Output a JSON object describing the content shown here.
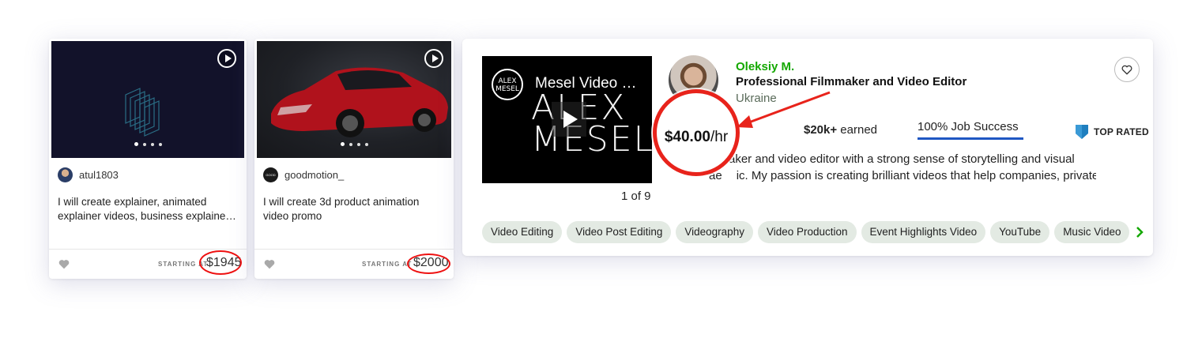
{
  "gig_cards": [
    {
      "seller": "atul1803",
      "title_line1": "I will create explainer, animated",
      "title_line2": "explainer videos, business explaine…",
      "starting_at": "STARTING AT",
      "price": "$1945"
    },
    {
      "seller": "goodmotion_",
      "seller_avatar_text": "GOOD MOTION",
      "title_line1": "I will create 3d product animation",
      "title_line2": "video promo",
      "starting_at": "STARTING AT",
      "price": "$2000"
    }
  ],
  "freelancer": {
    "name": "Oleksiy M.",
    "headline": "Professional Filmmaker and Video Editor",
    "country": "Ukraine",
    "video": {
      "logo_line1": "ALEX",
      "logo_line2": "MESEL",
      "title": "Mesel Video …",
      "bg_line1": "ALEX",
      "bg_line2": "MESEL",
      "counter": "1 of 9"
    },
    "rate_amount": "$40.00",
    "rate_unit": "/hr",
    "earned_amount": "$20k+",
    "earned_label": " earned",
    "job_success": "100% Job Success",
    "badge": "TOP RATED",
    "overview_line1": "aker and video editor with a strong sense of storytelling and visual",
    "overview_line2": "ic. My passion is creating brilliant videos that help companies, private…",
    "overview_prefix2": "ae",
    "skills": [
      "Video Editing",
      "Video Post Editing",
      "Videography",
      "Video Production",
      "Event Highlights Video",
      "YouTube",
      "Music Video"
    ]
  },
  "colors": {
    "accent_green": "#14a800",
    "highlight_red": "#e8231b",
    "jss_blue": "#1f57c3",
    "badge_blue": "#1f7fbf"
  }
}
